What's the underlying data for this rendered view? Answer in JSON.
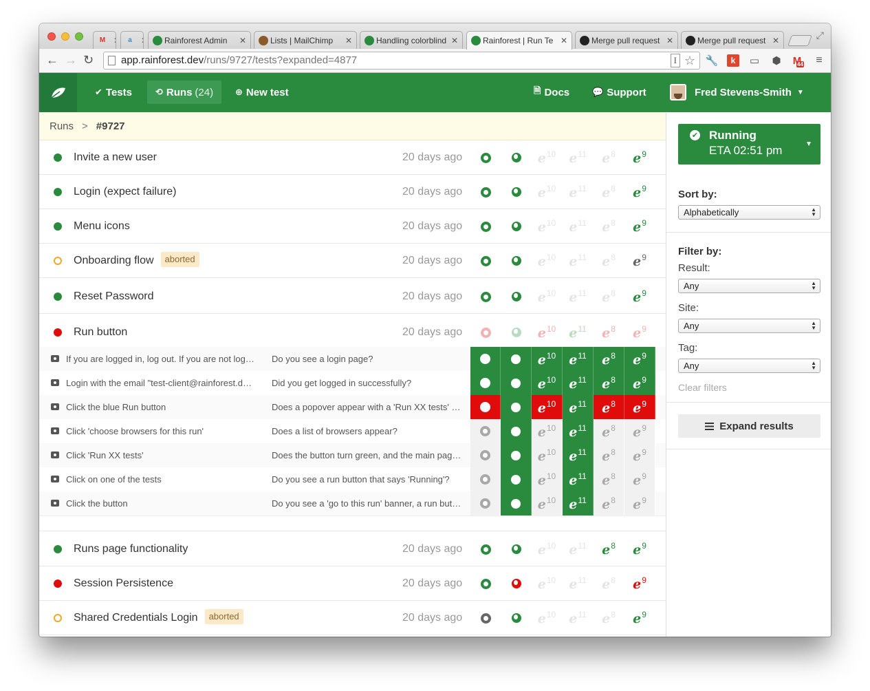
{
  "browser": {
    "tabs": [
      {
        "fav": "gmail",
        "title": "",
        "color": "#e8e8e8"
      },
      {
        "fav": "aws",
        "title": "",
        "color": "#e8e8e8"
      },
      {
        "fav": "rainforest",
        "title": "Rainforest Admin",
        "color": "#2a8a3e"
      },
      {
        "fav": "mailchimp",
        "title": "Lists | MailChimp",
        "color": "#8b5a2b"
      },
      {
        "fav": "rainforest",
        "title": "Handling colorblind",
        "color": "#2a8a3e"
      },
      {
        "fav": "rainforest",
        "title": "Rainforest | Run Te",
        "color": "#2a8a3e"
      },
      {
        "fav": "github",
        "title": "Merge pull request",
        "color": "#222"
      },
      {
        "fav": "github",
        "title": "Merge pull request",
        "color": "#222"
      }
    ],
    "url_host": "app.rainforest.dev",
    "url_path": "/runs/9727/tests?expanded=4877",
    "gmail_count": "44"
  },
  "header": {
    "nav": {
      "tests": "Tests",
      "runs": "Runs",
      "runs_count": "(24)",
      "new_test": "New test",
      "docs": "Docs",
      "support": "Support",
      "user": "Fred Stevens-Smith"
    }
  },
  "breadcrumb": {
    "parent": "Runs",
    "separator": ">",
    "current": "#9727"
  },
  "browsers": [
    "chrome",
    "firefox",
    "ie10",
    "ie11",
    "ie8",
    "ie9"
  ],
  "ie_versions": {
    "ie10": "10",
    "ie11": "11",
    "ie8": "8",
    "ie9": "9"
  },
  "colors": {
    "pass": "#2a8a3e",
    "fail": "#e00c0c",
    "grey": "#a8a8a8",
    "faint": "#e4e4e4",
    "aborted": "#f5a623"
  },
  "tests_top": [
    {
      "name": "Invite a new user",
      "status": "passed",
      "badge": "",
      "time": "20 days ago",
      "browsers": {
        "chrome": "pass",
        "firefox": "pass",
        "ie10": "na",
        "ie11": "na",
        "ie8": "na",
        "ie9": "pass"
      }
    },
    {
      "name": "Login (expect failure)",
      "status": "passed",
      "badge": "",
      "time": "20 days ago",
      "browsers": {
        "chrome": "pass",
        "firefox": "pass",
        "ie10": "na",
        "ie11": "na",
        "ie8": "na",
        "ie9": "pass"
      }
    },
    {
      "name": "Menu icons",
      "status": "passed",
      "badge": "",
      "time": "20 days ago",
      "browsers": {
        "chrome": "pass",
        "firefox": "pass",
        "ie10": "na",
        "ie11": "na",
        "ie8": "na",
        "ie9": "pass"
      }
    },
    {
      "name": "Onboarding flow",
      "status": "aborted",
      "badge": "aborted",
      "time": "20 days ago",
      "browsers": {
        "chrome": "pass",
        "firefox": "pass",
        "ie10": "na",
        "ie11": "na",
        "ie8": "na",
        "ie9": "grey"
      }
    },
    {
      "name": "Reset Password",
      "status": "passed",
      "badge": "",
      "time": "20 days ago",
      "browsers": {
        "chrome": "pass",
        "firefox": "pass",
        "ie10": "na",
        "ie11": "na",
        "ie8": "na",
        "ie9": "pass"
      }
    },
    {
      "name": "Run button",
      "status": "failed",
      "badge": "",
      "time": "20 days ago",
      "browsers": {
        "chrome": "failfaint",
        "firefox": "passfaint",
        "ie10": "failfaint",
        "ie11": "passfaint",
        "ie8": "failfaint",
        "ie9": "failfaint"
      }
    }
  ],
  "steps": [
    {
      "action": "If you are logged in, log out. If you are not logged in, continue.",
      "question": "Do you see a login page?",
      "results": {
        "chrome": "pass",
        "firefox": "pass",
        "ie10": "pass",
        "ie11": "pass",
        "ie8": "pass",
        "ie9": "pass"
      }
    },
    {
      "action": "Login with the email \"test-client@rainforest.dev\"",
      "question": "Did you get logged in successfully?",
      "results": {
        "chrome": "pass",
        "firefox": "pass",
        "ie10": "pass",
        "ie11": "pass",
        "ie8": "pass",
        "ie9": "pass"
      }
    },
    {
      "action": "Click the blue Run button",
      "question": "Does a popover appear with a 'Run XX tests' button?",
      "results": {
        "chrome": "fail",
        "firefox": "pass",
        "ie10": "fail",
        "ie11": "pass",
        "ie8": "fail",
        "ie9": "fail"
      }
    },
    {
      "action": "Click 'choose browsers for this run'",
      "question": "Does a list of browsers appear?",
      "results": {
        "chrome": "none",
        "firefox": "pass",
        "ie10": "none",
        "ie11": "pass",
        "ie8": "none",
        "ie9": "none"
      }
    },
    {
      "action": "Click 'Run XX tests'",
      "question": "Does the button turn green, and the main page update?",
      "results": {
        "chrome": "none",
        "firefox": "pass",
        "ie10": "none",
        "ie11": "pass",
        "ie8": "none",
        "ie9": "none"
      }
    },
    {
      "action": "Click on one of the tests",
      "question": "Do you see a run button that says 'Running'?",
      "results": {
        "chrome": "none",
        "firefox": "pass",
        "ie10": "none",
        "ie11": "pass",
        "ie8": "none",
        "ie9": "none"
      }
    },
    {
      "action": "Click the button",
      "question": "Do you see a 'go to this run' banner, a run button and a list?",
      "results": {
        "chrome": "none",
        "firefox": "pass",
        "ie10": "none",
        "ie11": "pass",
        "ie8": "none",
        "ie9": "none"
      }
    }
  ],
  "tests_bottom": [
    {
      "name": "Runs page functionality",
      "status": "passed",
      "badge": "",
      "time": "20 days ago",
      "browsers": {
        "chrome": "pass",
        "firefox": "pass",
        "ie10": "na",
        "ie11": "na",
        "ie8": "pass",
        "ie9": "pass"
      }
    },
    {
      "name": "Session Persistence",
      "status": "failed",
      "badge": "",
      "time": "20 days ago",
      "browsers": {
        "chrome": "pass",
        "firefox": "fail",
        "ie10": "na",
        "ie11": "na",
        "ie8": "na",
        "ie9": "fail"
      }
    },
    {
      "name": "Shared Credentials Login",
      "status": "aborted",
      "badge": "aborted",
      "time": "20 days ago",
      "browsers": {
        "chrome": "grey",
        "firefox": "pass",
        "ie10": "na",
        "ie11": "na",
        "ie8": "na",
        "ie9": "pass"
      }
    }
  ],
  "sidebar": {
    "run_status": "Running",
    "eta": "ETA 02:51 pm",
    "sort_label": "Sort by:",
    "sort_value": "Alphabetically",
    "filter_label": "Filter by:",
    "result_label": "Result:",
    "result_value": "Any",
    "site_label": "Site:",
    "site_value": "Any",
    "tag_label": "Tag:",
    "tag_value": "Any",
    "clear_filters": "Clear filters",
    "expand_results": "Expand results"
  }
}
